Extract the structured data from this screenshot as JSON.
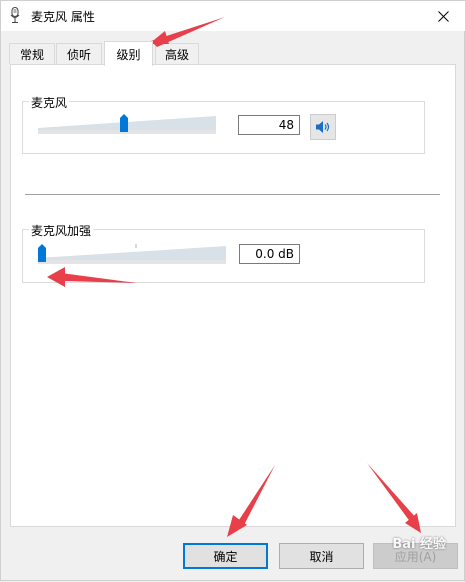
{
  "window": {
    "title": "麦克风 属性"
  },
  "tabs": [
    {
      "label": "常规",
      "active": false
    },
    {
      "label": "侦听",
      "active": false
    },
    {
      "label": "级别",
      "active": true
    },
    {
      "label": "高级",
      "active": false
    }
  ],
  "microphone": {
    "label": "麦克风",
    "value": "48",
    "level": 48
  },
  "boost": {
    "label": "麦克风加强",
    "value": "0.0 dB",
    "level": 0
  },
  "buttons": {
    "ok": "确定",
    "cancel": "取消",
    "apply": "应用(A)"
  },
  "watermark": "Bai 经验",
  "colors": {
    "accent": "#0078d7",
    "annotation": "#e8404a"
  }
}
